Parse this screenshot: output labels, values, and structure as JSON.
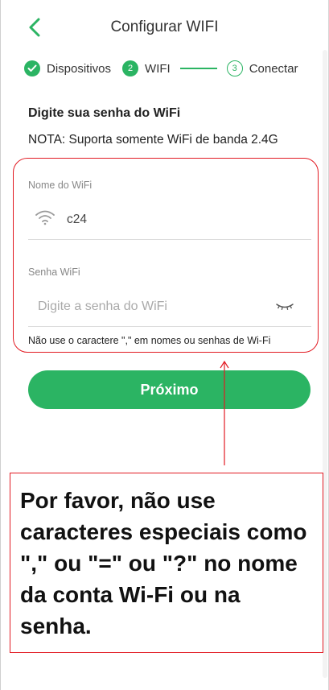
{
  "header": {
    "title": "Configurar WIFI",
    "back_icon": "chevron-left-icon"
  },
  "steps": [
    {
      "label": "Dispositivos",
      "marker": "✓",
      "state": "done"
    },
    {
      "label": "WIFI",
      "marker": "2",
      "state": "current"
    },
    {
      "label": "Conectar",
      "marker": "3",
      "state": "pending"
    }
  ],
  "page": {
    "heading": "Digite sua senha do WiFi",
    "note": "NOTA: Suporta somente WiFi de banda 2.4G"
  },
  "form": {
    "wifi_label": "Nome do WiFi",
    "wifi_value": "c24",
    "password_label": "Senha WiFi",
    "password_placeholder": "Digite a senha do WiFi",
    "warning": "Não use o caractere \",\" em nomes ou senhas de Wi-Fi"
  },
  "actions": {
    "next_label": "Próximo"
  },
  "annotation": {
    "text": "Por favor, não use caracteres especiais como \",\" ou \"=\" ou \"?\" no nome da conta Wi-Fi ou na senha."
  },
  "colors": {
    "accent": "#2bb463",
    "annotation_red": "#e21b23"
  }
}
